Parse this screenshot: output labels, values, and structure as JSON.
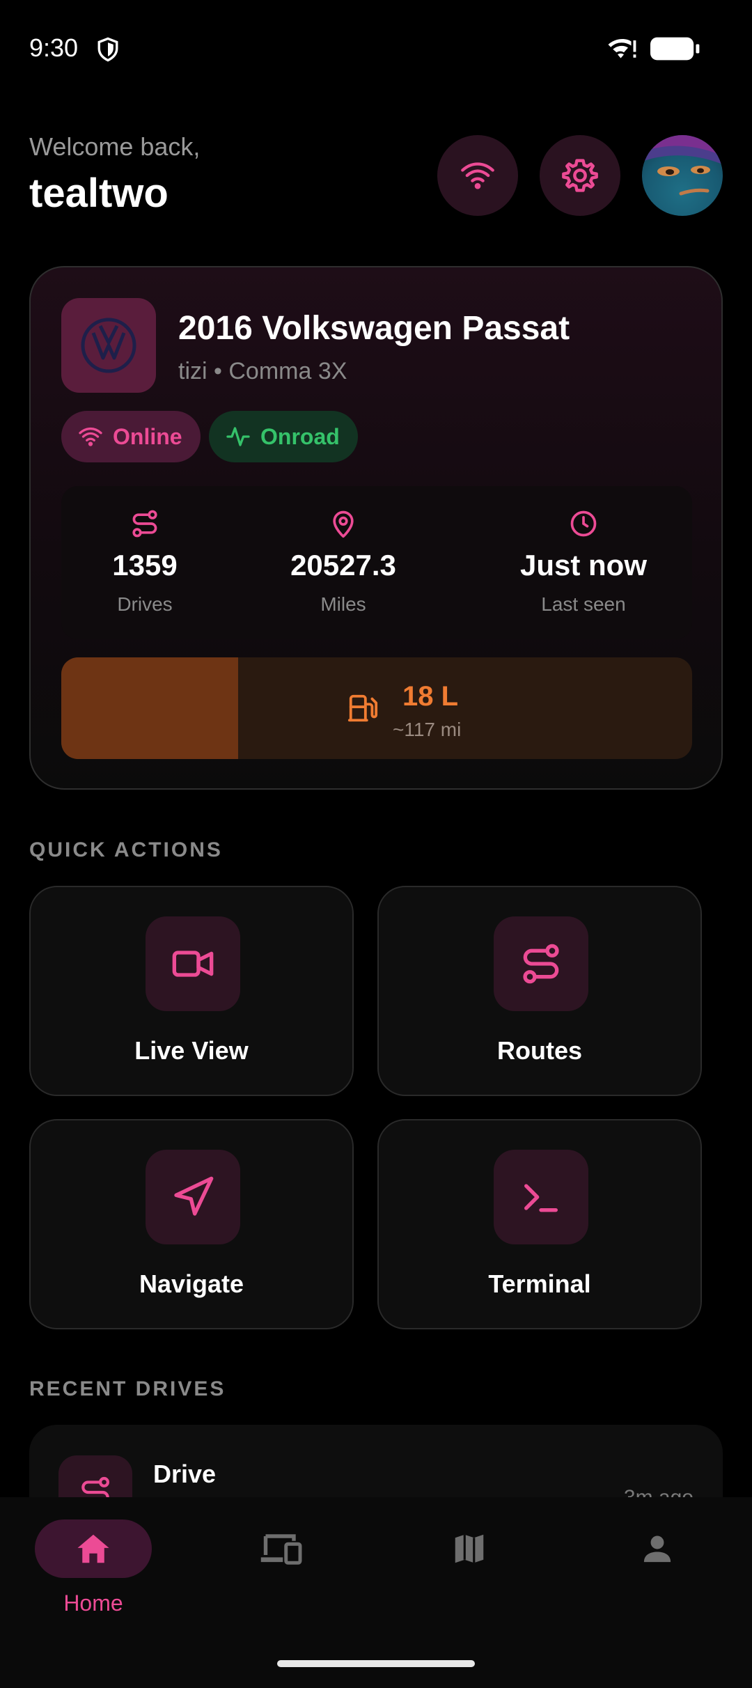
{
  "status_bar": {
    "time": "9:30"
  },
  "header": {
    "welcome": "Welcome back,",
    "username": "tealtwo"
  },
  "vehicle": {
    "title": "2016 Volkswagen Passat",
    "subtitle": "tizi • Comma 3X",
    "status_chips": [
      {
        "label": "Online",
        "color": "#ec4b95"
      },
      {
        "label": "Onroad",
        "color": "#35c26a"
      }
    ],
    "stats": [
      {
        "value": "1359",
        "label": "Drives",
        "icon": "route-icon"
      },
      {
        "value": "20527.3",
        "label": "Miles",
        "icon": "map-pin-icon"
      },
      {
        "value": "Just now",
        "label": "Last seen",
        "icon": "clock-icon"
      }
    ],
    "fuel": {
      "value": "18 L",
      "range": "~117 mi",
      "level_fraction": 0.28
    }
  },
  "quick_actions": {
    "title": "QUICK ACTIONS",
    "items": [
      {
        "label": "Live View",
        "icon": "video-camera-icon"
      },
      {
        "label": "Routes",
        "icon": "route-icon"
      },
      {
        "label": "Navigate",
        "icon": "navigation-arrow-icon"
      },
      {
        "label": "Terminal",
        "icon": "terminal-icon"
      }
    ]
  },
  "recent_drives": {
    "title": "RECENT DRIVES",
    "items": [
      {
        "name": "Drive",
        "time": "3m ago"
      }
    ]
  },
  "bottom_nav": {
    "items": [
      {
        "label": "Home",
        "icon": "home-icon",
        "active": true
      },
      {
        "label": "",
        "icon": "devices-icon",
        "active": false
      },
      {
        "label": "",
        "icon": "map-icon",
        "active": false
      },
      {
        "label": "",
        "icon": "person-icon",
        "active": false
      }
    ]
  },
  "colors": {
    "accent": "#ec4b95",
    "success": "#35c26a",
    "fuel": "#f07c32",
    "background": "#000000"
  }
}
